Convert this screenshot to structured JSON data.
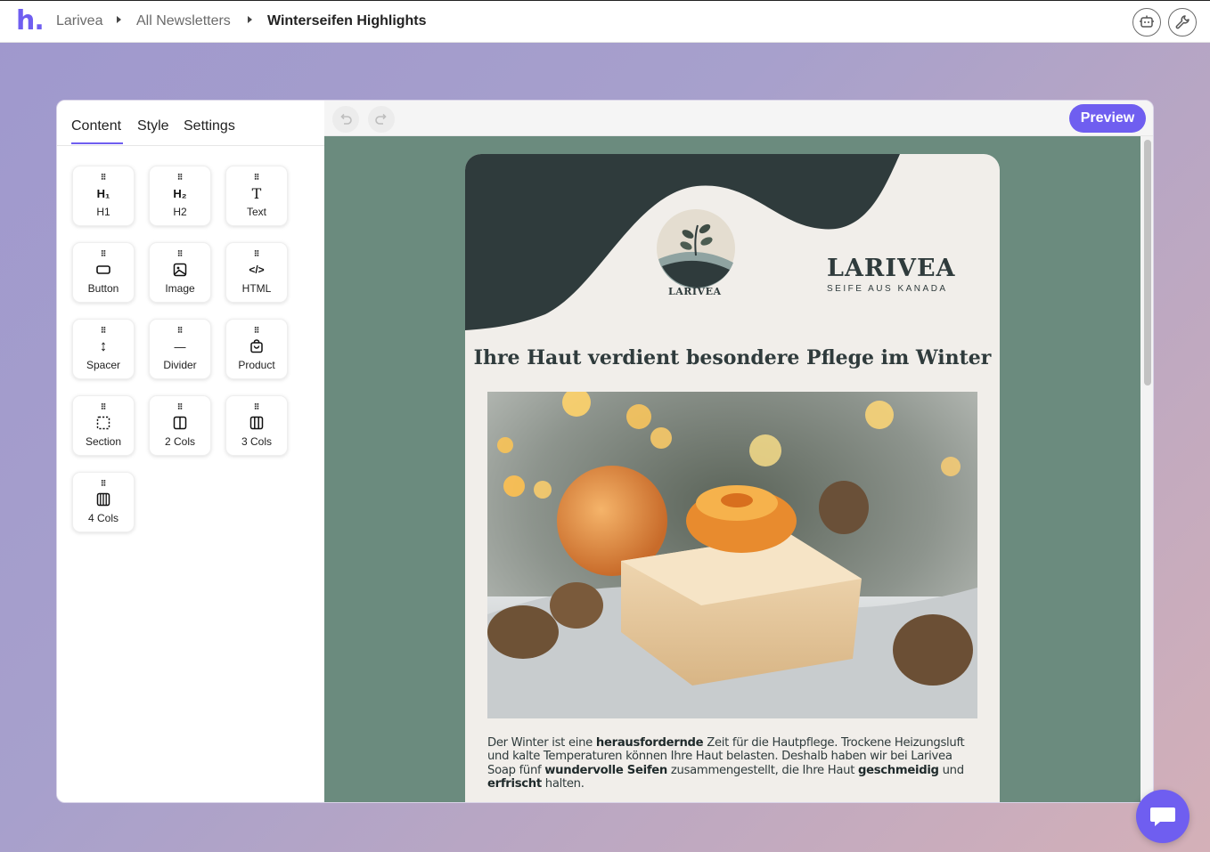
{
  "app": {
    "logo_text": "h."
  },
  "breadcrumb": {
    "items": [
      "Larivea",
      "All Newsletters",
      "Winterseifen Highlights"
    ]
  },
  "sidebar": {
    "tabs": [
      "Content",
      "Style",
      "Settings"
    ],
    "active_tab": "Content",
    "blocks": [
      {
        "label": "H1",
        "icon": "heading-1-icon",
        "glyph": "H₁"
      },
      {
        "label": "H2",
        "icon": "heading-2-icon",
        "glyph": "H₂"
      },
      {
        "label": "Text",
        "icon": "text-icon",
        "glyph": "T"
      },
      {
        "label": "Button",
        "icon": "button-icon",
        "glyph": ""
      },
      {
        "label": "Image",
        "icon": "image-icon",
        "glyph": ""
      },
      {
        "label": "HTML",
        "icon": "code-icon",
        "glyph": "</>"
      },
      {
        "label": "Spacer",
        "icon": "spacer-icon",
        "glyph": "↕"
      },
      {
        "label": "Divider",
        "icon": "divider-icon",
        "glyph": "—"
      },
      {
        "label": "Product",
        "icon": "shopping-bag-icon",
        "glyph": ""
      },
      {
        "label": "Section",
        "icon": "section-icon",
        "glyph": ""
      },
      {
        "label": "2 Cols",
        "icon": "two-columns-icon",
        "glyph": ""
      },
      {
        "label": "3 Cols",
        "icon": "three-columns-icon",
        "glyph": ""
      },
      {
        "label": "4 Cols",
        "icon": "four-columns-icon",
        "glyph": ""
      }
    ]
  },
  "toolbar": {
    "preview_label": "Preview"
  },
  "email": {
    "brand_title": "LARIVEA",
    "brand_subtitle": "SEIFE AUS KANADA",
    "logo_caption": "LARIVEA",
    "headline": "Ihre Haut verdient besondere Pflege im Winter",
    "body": {
      "p1": "Der Winter ist eine ",
      "b1": "herausfordernde",
      "p2": " Zeit für die Hautpflege. Trockene Heizungsluft und kalte Temperaturen können Ihre Haut belasten. Deshalb haben wir bei Larivea Soap fünf ",
      "b2": "wundervolle Seifen",
      "p3": " zusammengestellt, die Ihre Haut ",
      "b3": "geschmeidig",
      "p4": " und ",
      "b4": "erfrischt",
      "p5": " halten."
    }
  },
  "colors": {
    "accent": "#6f5ef0",
    "canvas_bg": "#6b8b7e",
    "email_bg": "#f1eeea",
    "email_dark": "#2f3b3c"
  }
}
